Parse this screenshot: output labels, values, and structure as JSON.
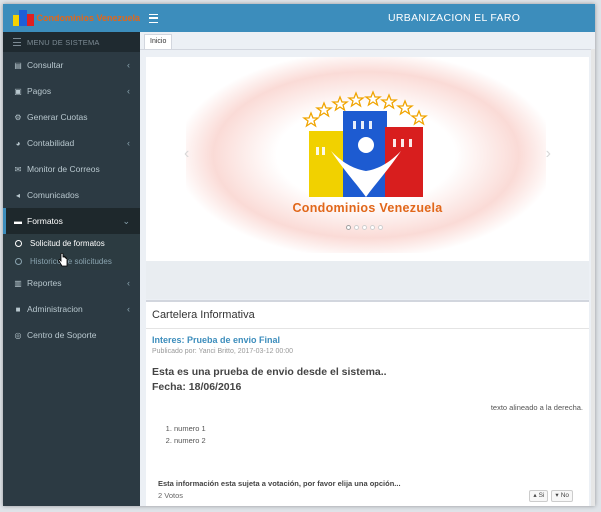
{
  "brand": {
    "name": "Condominios Venezuela"
  },
  "menu_header": "MENU DE SISTEMA",
  "header": {
    "title": "URBANIZACION EL FARO"
  },
  "colors": {
    "primary": "#3c8dbc",
    "sidebar": "#2c3a43",
    "brand_orange": "#e1671a"
  },
  "sidebar": {
    "items": [
      {
        "label": "Consultar",
        "icon": "document-icon"
      },
      {
        "label": "Pagos",
        "icon": "money-icon"
      },
      {
        "label": "Generar Cuotas",
        "icon": "cogs-icon"
      },
      {
        "label": "Contabilidad",
        "icon": "pie-chart-icon"
      },
      {
        "label": "Monitor de Correos",
        "icon": "envelope-icon"
      },
      {
        "label": "Comunicados",
        "icon": "bullhorn-icon"
      },
      {
        "label": "Formatos",
        "icon": "file-icon"
      },
      {
        "label": "Reportes",
        "icon": "bar-chart-icon"
      },
      {
        "label": "Administracion",
        "icon": "briefcase-icon"
      },
      {
        "label": "Centro de Soporte",
        "icon": "lifebuoy-icon"
      }
    ],
    "formatos_sub": [
      {
        "label": "Solicitud de formatos"
      },
      {
        "label": "Historico de solicitudes"
      }
    ]
  },
  "tabs": [
    {
      "label": "Inicio"
    }
  ],
  "carousel": {
    "logo_text": "Condominios Venezuela",
    "slides": 5,
    "active_slide": 1
  },
  "board": {
    "title": "Cartelera Informativa",
    "post_title": "Interes:  Prueba de envio Final",
    "post_meta": "Publicado por:  Yanci Britto, 2017-03-12 00:00",
    "body_line1": "Esta es una prueba de envio desde el sistema..",
    "body_line2": "Fecha: 18/06/2016",
    "right_text": "texto alineado a la derecha.",
    "list": [
      "numero 1",
      "numero 2"
    ],
    "vote_question": "Esta información esta sujeta a votación, por favor elija una opción...",
    "vote_count": "2 Votos",
    "vote_yes": "Si",
    "vote_no": "No"
  }
}
